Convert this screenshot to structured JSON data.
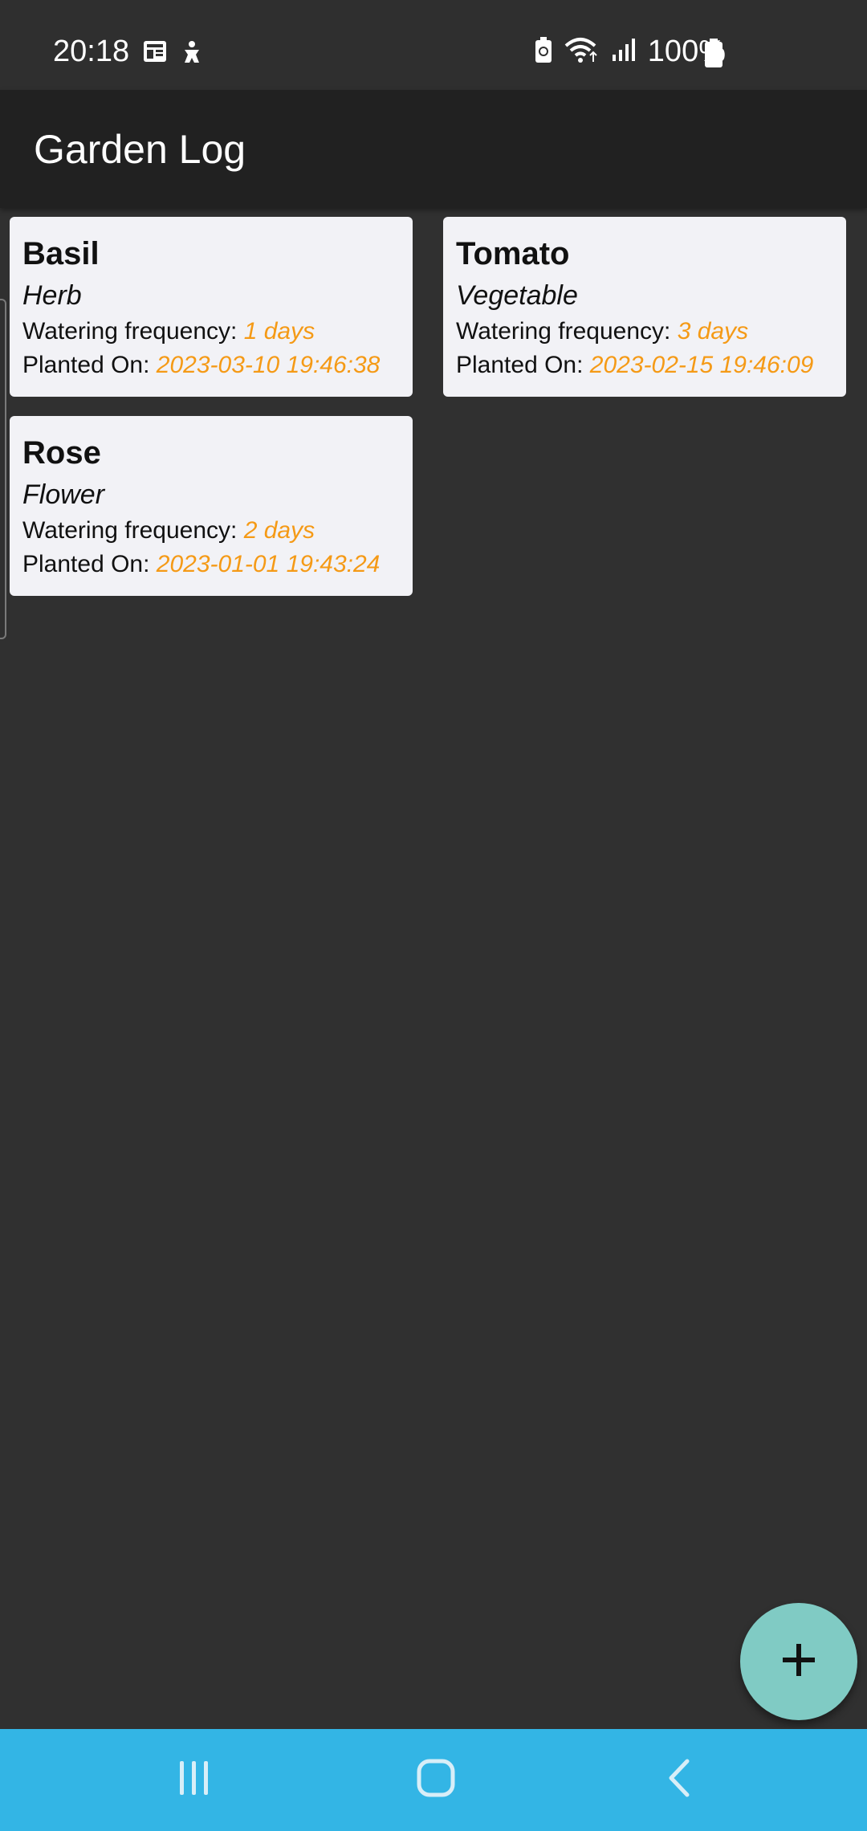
{
  "status_bar": {
    "time": "20:18",
    "battery_percent": "100%",
    "left_icons": [
      "news-icon",
      "accessibility-icon"
    ],
    "right_icons": [
      "battery-saver-icon",
      "wifi-icon",
      "signal-icon",
      "battery-icon"
    ]
  },
  "app": {
    "title": "Garden Log",
    "accent_color": "#f59a16",
    "fab_color": "#80cbc4",
    "nav_color": "#33b5e5"
  },
  "labels": {
    "watering_prefix": "Watering frequency: ",
    "planted_prefix": "Planted On: "
  },
  "plants": [
    {
      "name": "Basil",
      "type": "Herb",
      "frequency": "1 days",
      "planted": "2023-03-10 19:46:38"
    },
    {
      "name": "Tomato",
      "type": "Vegetable",
      "frequency": "3 days",
      "planted": "2023-02-15 19:46:09"
    },
    {
      "name": "Rose",
      "type": "Flower",
      "frequency": "2 days",
      "planted": "2023-01-01 19:43:24"
    }
  ],
  "fab": {
    "icon": "plus-icon"
  },
  "nav": {
    "icons": [
      "recent-apps-icon",
      "home-icon",
      "back-icon"
    ]
  }
}
